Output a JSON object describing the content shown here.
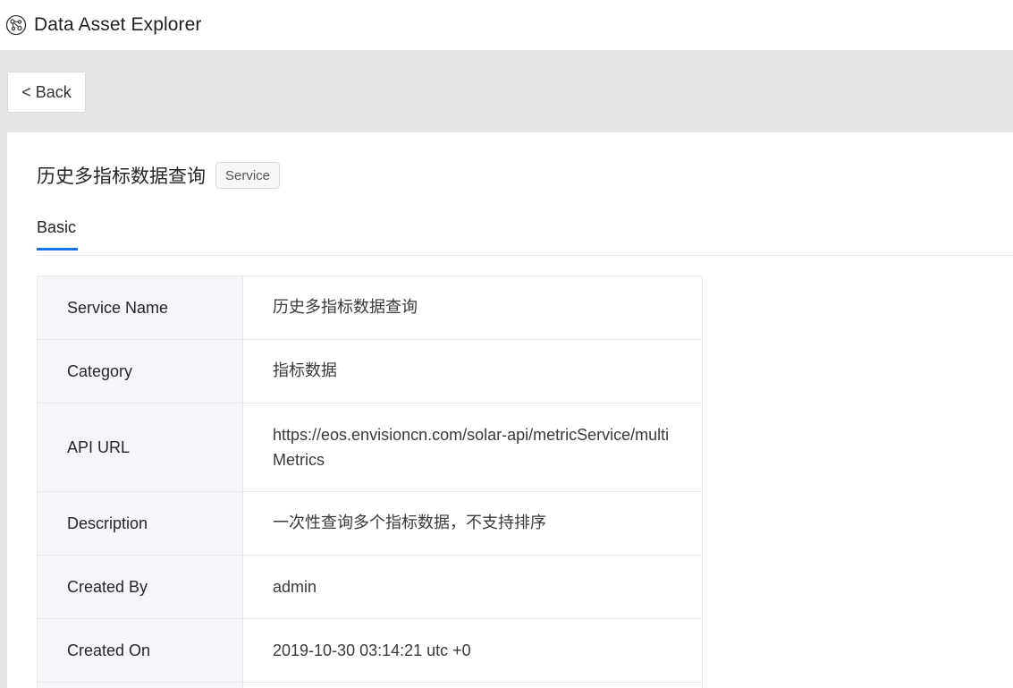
{
  "app": {
    "title": "Data Asset Explorer",
    "logo_icon": "network-nodes-icon"
  },
  "nav": {
    "back_label": "< Back"
  },
  "page": {
    "title": "历史多指标数据查询",
    "badge": "Service"
  },
  "tabs": [
    {
      "label": "Basic",
      "active": true
    }
  ],
  "details": [
    {
      "label": "Service Name",
      "value": "历史多指标数据查询"
    },
    {
      "label": "Category",
      "value": "指标数据"
    },
    {
      "label": "API URL",
      "value": "https://eos.envisioncn.com/solar-api/metricService/multiMetrics"
    },
    {
      "label": "Description",
      "value": "一次性查询多个指标数据，不支持排序"
    },
    {
      "label": "Created By",
      "value": "admin"
    },
    {
      "label": "Created On",
      "value": "2019-10-30 03:14:21 utc +0"
    }
  ],
  "colors": {
    "accent": "#1a73e8",
    "band": "#e6e6e6",
    "label_bg": "#f5f5fa"
  }
}
